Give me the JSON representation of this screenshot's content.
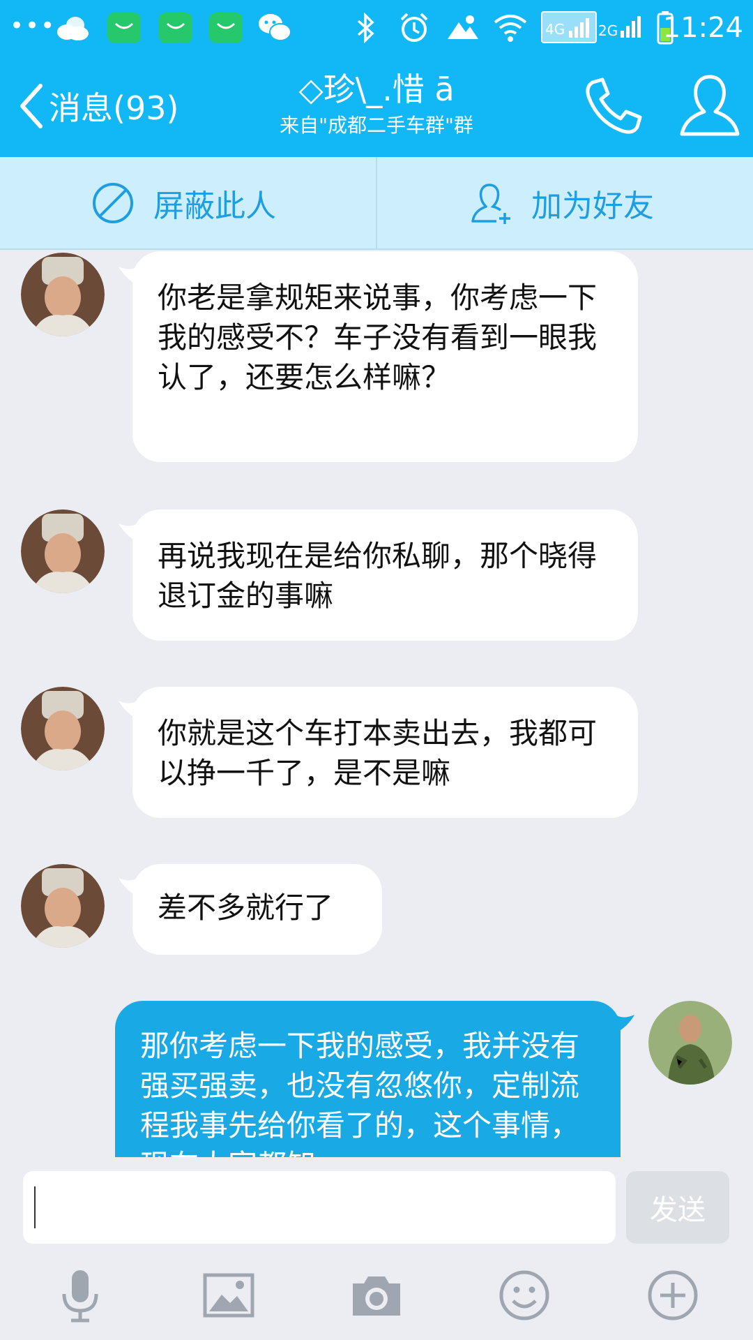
{
  "status_bar": {
    "signal_4g": "4G",
    "signal_2g": "2G",
    "time": "11:24"
  },
  "header": {
    "back_label": "消息(93)",
    "title": "◇珍\\_.惜 ā",
    "subtitle": "来自\"成都二手车群\"群",
    "phone_icon": "phone-icon",
    "profile_icon": "person-icon"
  },
  "actions": {
    "block_label": "屏蔽此人",
    "add_friend_label": "加为好友"
  },
  "messages": [
    {
      "side": "in",
      "text": "你老是拿规矩来说事，你考虑一下我的感受不？车子没有看到一眼我认了，还要怎么样嘛？"
    },
    {
      "side": "in",
      "text": "再说我现在是给你私聊，那个晓得退订金的事嘛"
    },
    {
      "side": "in",
      "text": "你就是这个车打本卖出去，我都可以挣一千了，是不是嘛"
    },
    {
      "side": "in",
      "text": "差不多就行了"
    },
    {
      "side": "out",
      "text": "那你考虑一下我的感受，我并没有强买强卖，也没有忽悠你，定制流程我事先给你看了的，这个事情，现在大家都知"
    }
  ],
  "input": {
    "value": "",
    "send_label": "发送"
  },
  "toolbar": [
    "mic-icon",
    "image-icon",
    "camera-icon",
    "emoji-icon",
    "plus-icon"
  ],
  "colors": {
    "brand": "#12b7f5",
    "action_bar": "#cdeefc",
    "outgoing_bubble": "#19a9e5",
    "background": "#ebedf2"
  }
}
